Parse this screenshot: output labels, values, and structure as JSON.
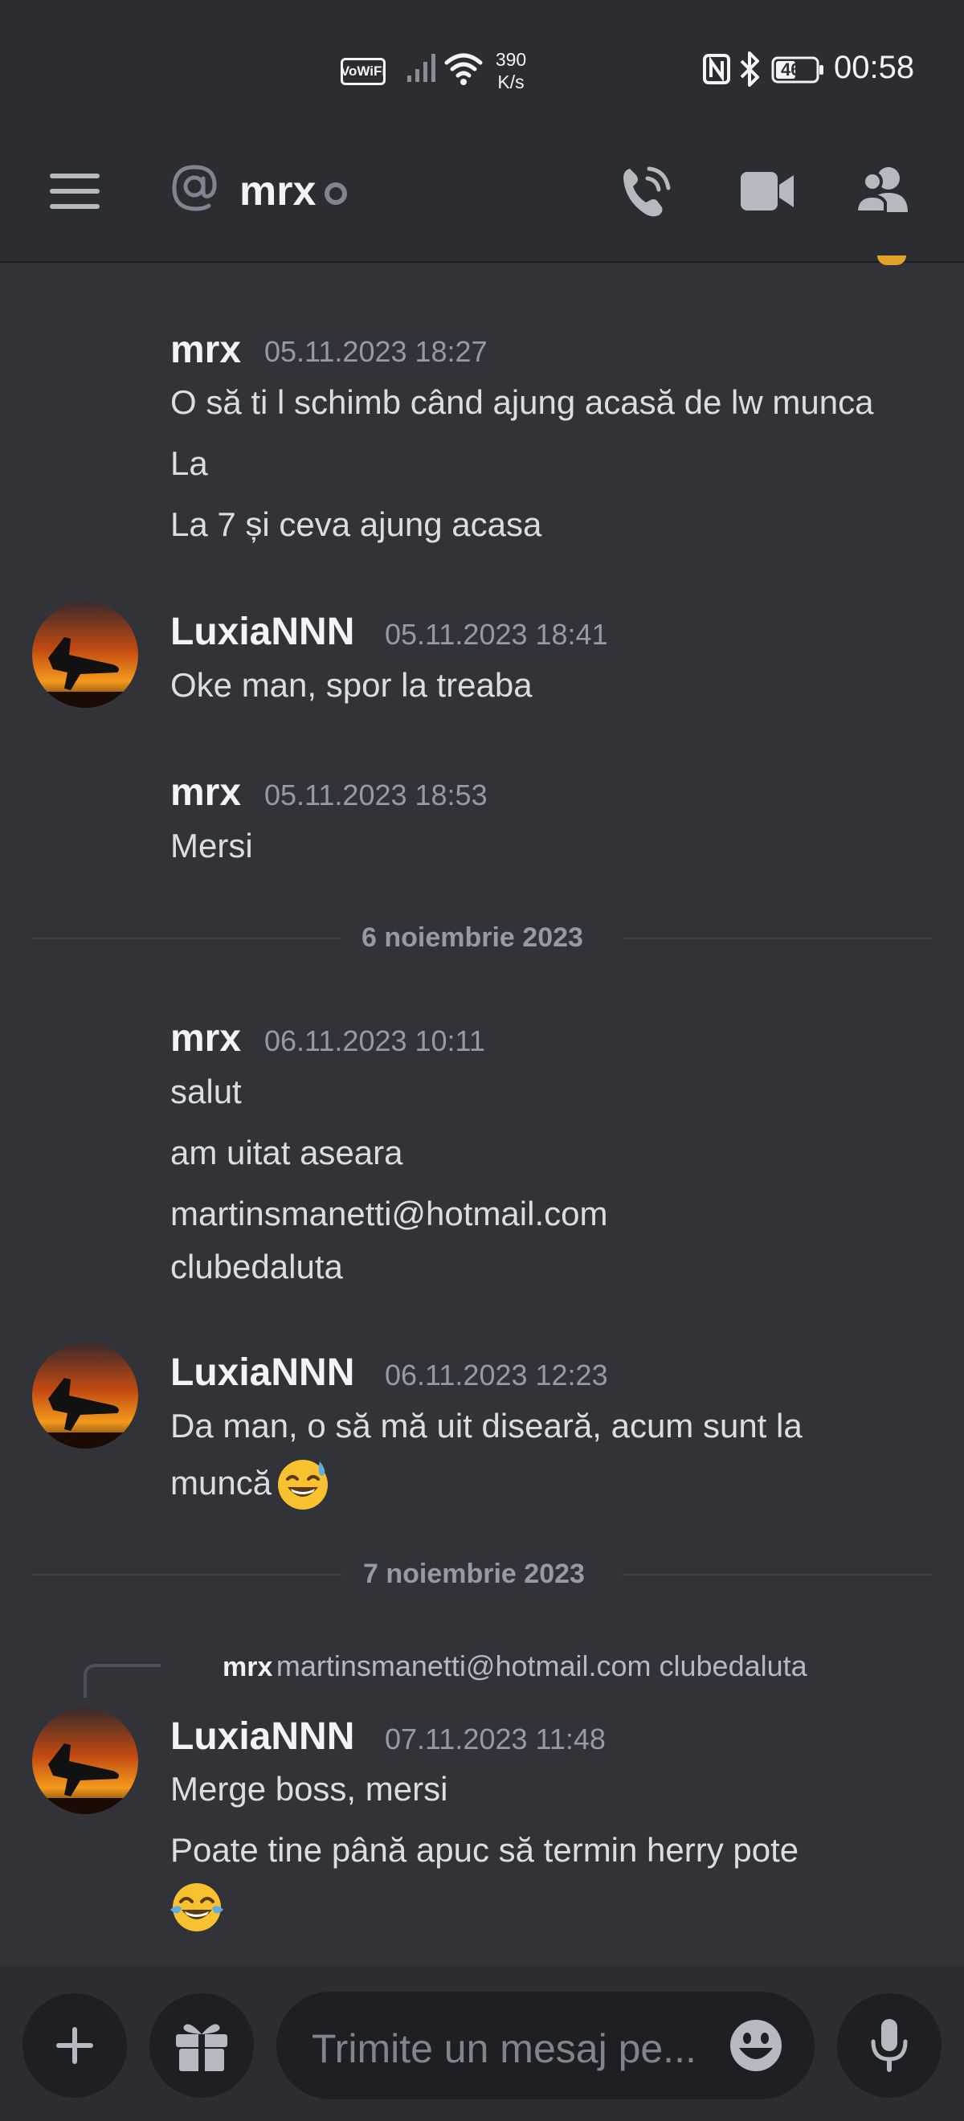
{
  "status_bar": {
    "vowifi": "VoWiFi",
    "net_speed_value": "390",
    "net_speed_unit": "K/s",
    "battery": "46",
    "time": "00:58"
  },
  "header": {
    "channel_name": "mrx"
  },
  "messages": [
    {
      "author": "mrx",
      "timestamp": "05.11.2023 18:27",
      "lines": [
        "O să ti l schimb când ajung acasă de lw munca",
        "La",
        "La 7 și ceva ajung acasa"
      ]
    },
    {
      "author": "LuxiaNNN",
      "timestamp": "05.11.2023 18:41",
      "lines": [
        "Oke man, spor la treaba"
      ]
    },
    {
      "author": "mrx",
      "timestamp": "05.11.2023 18:53",
      "lines": [
        "Mersi"
      ]
    },
    {
      "author": "mrx",
      "timestamp": "06.11.2023 10:11",
      "lines": [
        "salut",
        "am uitat aseara",
        "martinsmanetti@hotmail.com",
        "clubedaluta"
      ]
    },
    {
      "author": "LuxiaNNN",
      "timestamp": "06.11.2023 12:23",
      "lines": [
        "Da man, o să mă uit diseară, acum sunt la",
        "muncă"
      ]
    },
    {
      "author": "LuxiaNNN",
      "timestamp": "07.11.2023 11:48",
      "lines": [
        "Merge boss, mersi",
        "Poate tine până apuc să termin herry pote"
      ]
    }
  ],
  "dividers": [
    "6 noiembrie 2023",
    "7 noiembrie 2023"
  ],
  "reply": {
    "author": "mrx",
    "text": "martinsmanetti@hotmail.com clubedaluta"
  },
  "composer": {
    "placeholder": "Trimite un mesaj pe..."
  },
  "colors": {
    "background": "#313338",
    "header": "#2b2d31",
    "text": "#dbdee1",
    "muted": "#949ba4"
  },
  "icons": [
    "menu-icon",
    "at-icon",
    "call-icon",
    "video-icon",
    "members-icon",
    "chevron-down-icon",
    "plus-icon",
    "gift-icon",
    "emoji-icon",
    "mic-icon"
  ]
}
